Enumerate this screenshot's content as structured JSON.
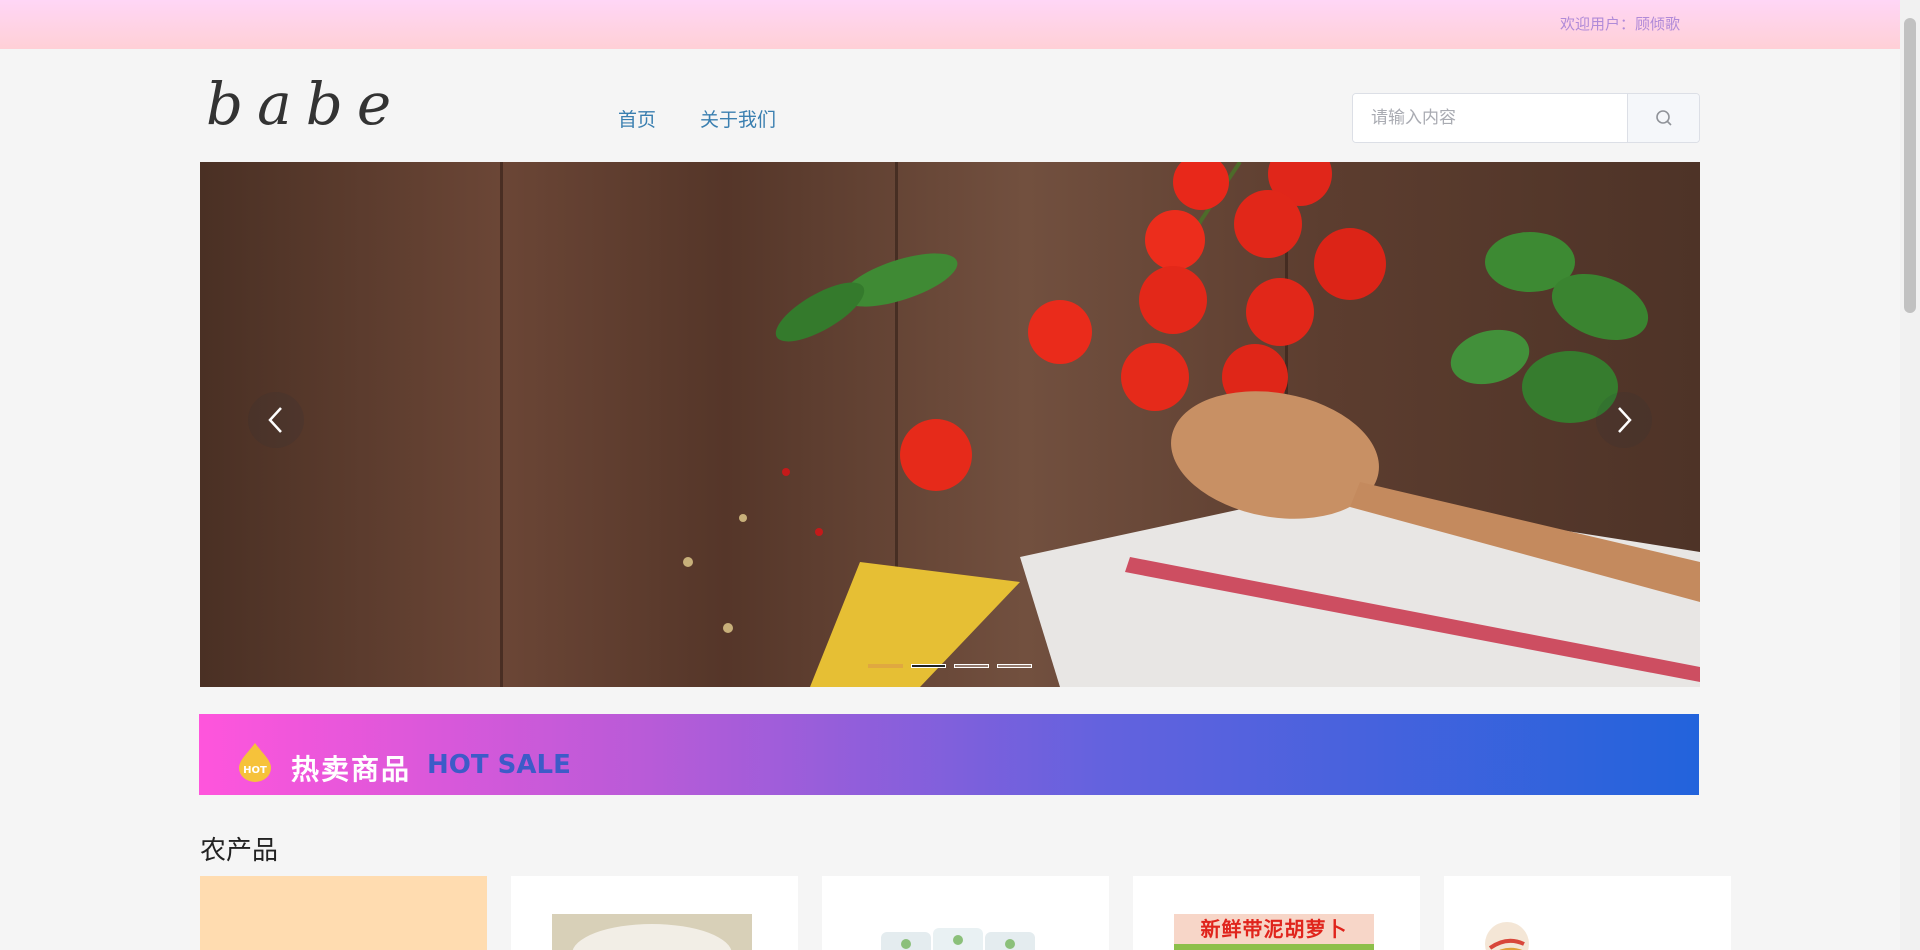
{
  "topbar": {
    "welcome_text": "欢迎用户：顾倾歌"
  },
  "header": {
    "logo_text": "babe",
    "nav": [
      {
        "label": "首页"
      },
      {
        "label": "关于我们"
      }
    ],
    "search": {
      "placeholder": "请输入内容",
      "value": ""
    }
  },
  "carousel": {
    "slide_count": 4,
    "active_index": 0
  },
  "hot_sale": {
    "title": "热卖商品",
    "subtitle": "HOT SALE",
    "badge": "HOT"
  },
  "section": {
    "title": "农产品"
  },
  "products": [
    {
      "image": "orange-tile"
    },
    {
      "image": "white-food-bowl"
    },
    {
      "image": "packaged-bags"
    },
    {
      "image": "carrot-poster",
      "caption": "新鲜带泥胡萝卜"
    },
    {
      "image": "logo-emblem"
    }
  ],
  "colors": {
    "accent_nav": "#3a7fb0",
    "welcome": "#b08ad8",
    "banner_start": "#ff55dc",
    "banner_end": "#2263dc"
  }
}
